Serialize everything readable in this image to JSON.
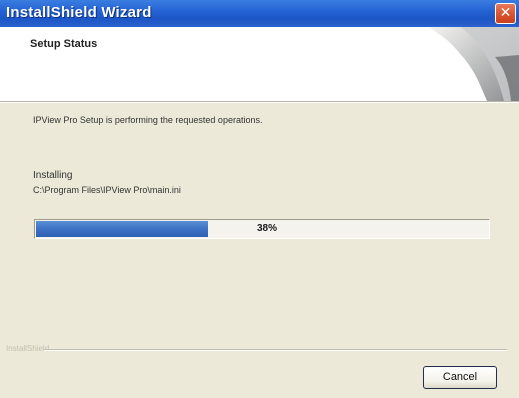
{
  "window": {
    "title": "InstallShield Wizard",
    "close_glyph": "✕"
  },
  "header": {
    "title": "Setup Status",
    "art_icon": "installshield-header-art"
  },
  "main": {
    "message": "IPView Pro Setup is performing the requested operations.",
    "status_label": "Installing",
    "file_path": "C:\\Program Files\\IPView Pro\\main.ini",
    "progress": {
      "value_fraction": 0.38,
      "label": "38%"
    }
  },
  "footer": {
    "brand": "InstallShield",
    "cancel_label": "Cancel"
  },
  "colors": {
    "titlebar": "#2563d4",
    "progress_fill": "#3d72c4",
    "dialog_bg": "#ece9d8"
  }
}
